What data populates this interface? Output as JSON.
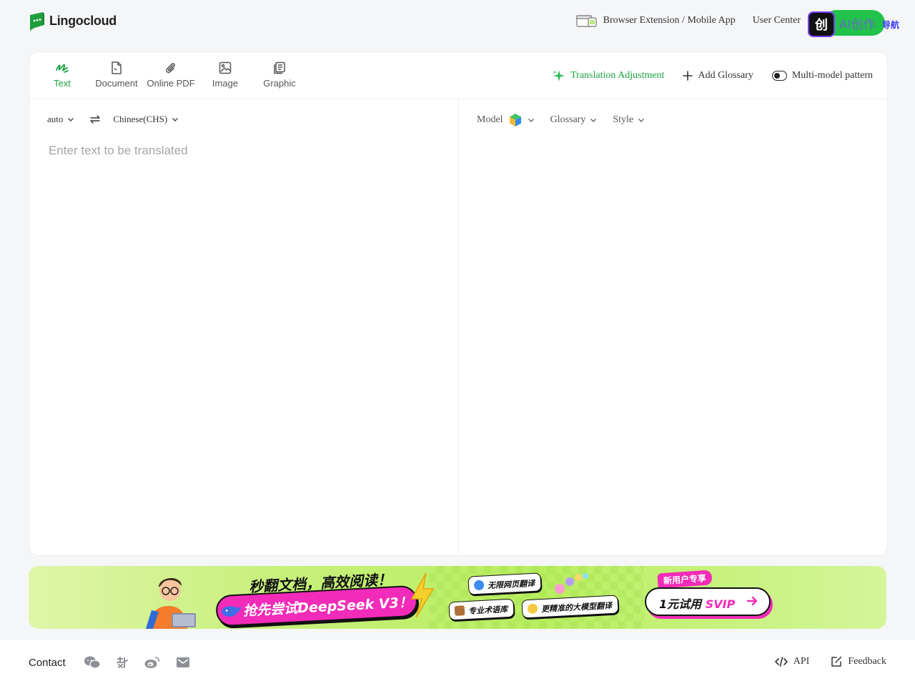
{
  "brand": {
    "name": "Lingocloud",
    "accent": "#1aa33f"
  },
  "header": {
    "links": [
      {
        "label": "Browser Extension / Mobile App",
        "icon": "browser-extension-icon"
      },
      {
        "label": "User Center"
      }
    ],
    "corner_badge": {
      "text": "AI创作",
      "sub": "导航"
    }
  },
  "tabs": [
    {
      "label": "Text",
      "icon": "text-scribble-icon",
      "active": true
    },
    {
      "label": "Document",
      "icon": "document-icon"
    },
    {
      "label": "Online PDF",
      "icon": "paperclip-icon"
    },
    {
      "label": "Image",
      "icon": "image-icon"
    },
    {
      "label": "Graphic",
      "icon": "graphic-icon"
    }
  ],
  "tools": {
    "adjust": "Translation Adjustment",
    "glossary": "Add Glossary",
    "multimodel": "Multi-model pattern"
  },
  "source": {
    "from_lang": "auto",
    "to_lang": "Chinese(CHS)",
    "placeholder": "Enter text to be translated"
  },
  "target": {
    "model": "Model",
    "glossary": "Glossary",
    "style": "Style"
  },
  "banner": {
    "headline": "秒翻文档，高效阅读！",
    "pill": "抢先尝试DeepSeek V3！",
    "chip_web": "无限网页翻译",
    "chip_terms": "专业术语库",
    "chip_llm": "更精准的大模型翻译",
    "new_user_tag": "新用户专享",
    "svip_prefix": "1元试用",
    "svip_highlight": "SVIP"
  },
  "footer": {
    "contact": "Contact",
    "api": "API",
    "feedback": "Feedback"
  }
}
